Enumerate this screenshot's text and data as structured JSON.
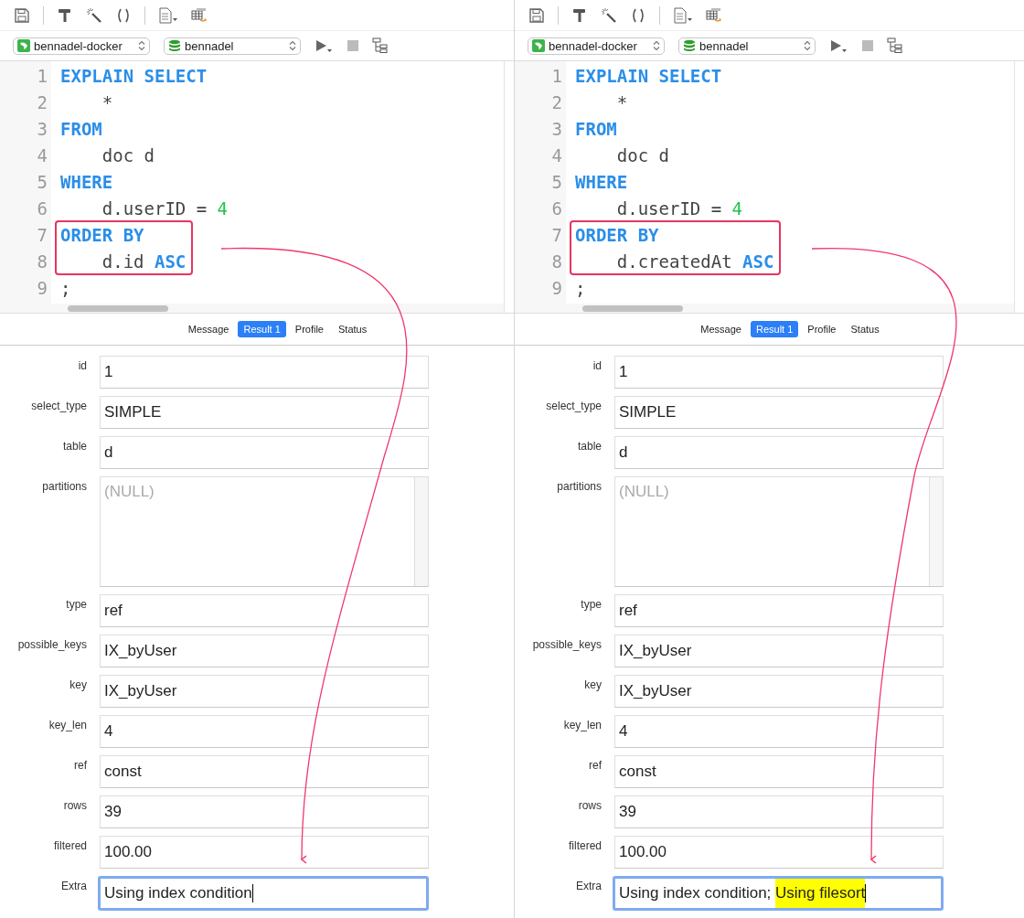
{
  "panes": [
    {
      "connection": "bennadel-docker",
      "database": "bennadel",
      "code_lines": [
        {
          "number": "1",
          "boxed": false,
          "tokens": [
            {
              "kind": "keyword",
              "text": "EXPLAIN SELECT"
            }
          ]
        },
        {
          "number": "2",
          "boxed": false,
          "tokens": [
            {
              "kind": "plain",
              "text": "    *"
            }
          ]
        },
        {
          "number": "3",
          "boxed": false,
          "tokens": [
            {
              "kind": "keyword",
              "text": "FROM"
            }
          ]
        },
        {
          "number": "4",
          "boxed": false,
          "tokens": [
            {
              "kind": "plain",
              "text": "    doc d"
            }
          ]
        },
        {
          "number": "5",
          "boxed": false,
          "tokens": [
            {
              "kind": "keyword",
              "text": "WHERE"
            }
          ]
        },
        {
          "number": "6",
          "boxed": false,
          "tokens": [
            {
              "kind": "plain",
              "text": "    d.userID = "
            },
            {
              "kind": "number",
              "text": "4"
            }
          ]
        },
        {
          "number": "7",
          "boxed": true,
          "tokens": [
            {
              "kind": "keyword",
              "text": "ORDER BY"
            }
          ]
        },
        {
          "number": "8",
          "boxed": true,
          "tokens": [
            {
              "kind": "plain",
              "text": "    d.id "
            },
            {
              "kind": "keyword",
              "text": "ASC"
            }
          ]
        },
        {
          "number": "9",
          "boxed": false,
          "tokens": [
            {
              "kind": "plain",
              "text": ";"
            }
          ]
        }
      ],
      "tabs": [
        {
          "label": "Message",
          "selected": false
        },
        {
          "label": "Result 1",
          "selected": true
        },
        {
          "label": "Profile",
          "selected": false
        },
        {
          "label": "Status",
          "selected": false
        }
      ],
      "fields": [
        {
          "label": "id",
          "kind": "text",
          "focused": false,
          "segments": [
            {
              "text": "1",
              "highlighted": false
            }
          ]
        },
        {
          "label": "select_type",
          "kind": "text",
          "focused": false,
          "segments": [
            {
              "text": "SIMPLE",
              "highlighted": false
            }
          ]
        },
        {
          "label": "table",
          "kind": "text",
          "focused": false,
          "segments": [
            {
              "text": "d",
              "highlighted": false
            }
          ]
        },
        {
          "label": "partitions",
          "kind": "null_memo",
          "focused": false,
          "segments": [
            {
              "text": "(NULL)",
              "highlighted": false
            }
          ]
        },
        {
          "label": "type",
          "kind": "text",
          "focused": false,
          "segments": [
            {
              "text": "ref",
              "highlighted": false
            }
          ]
        },
        {
          "label": "possible_keys",
          "kind": "text",
          "focused": false,
          "segments": [
            {
              "text": "IX_byUser",
              "highlighted": false
            }
          ]
        },
        {
          "label": "key",
          "kind": "text",
          "focused": false,
          "segments": [
            {
              "text": "IX_byUser",
              "highlighted": false
            }
          ]
        },
        {
          "label": "key_len",
          "kind": "text",
          "focused": false,
          "segments": [
            {
              "text": "4",
              "highlighted": false
            }
          ]
        },
        {
          "label": "ref",
          "kind": "text",
          "focused": false,
          "segments": [
            {
              "text": "const",
              "highlighted": false
            }
          ]
        },
        {
          "label": "rows",
          "kind": "text",
          "focused": false,
          "segments": [
            {
              "text": "39",
              "highlighted": false
            }
          ]
        },
        {
          "label": "filtered",
          "kind": "text",
          "focused": false,
          "segments": [
            {
              "text": "100.00",
              "highlighted": false
            }
          ]
        },
        {
          "label": "Extra",
          "kind": "text",
          "focused": true,
          "segments": [
            {
              "text": "Using index condition",
              "highlighted": false
            }
          ]
        }
      ]
    },
    {
      "connection": "bennadel-docker",
      "database": "bennadel",
      "code_lines": [
        {
          "number": "1",
          "boxed": false,
          "tokens": [
            {
              "kind": "keyword",
              "text": "EXPLAIN SELECT"
            }
          ]
        },
        {
          "number": "2",
          "boxed": false,
          "tokens": [
            {
              "kind": "plain",
              "text": "    *"
            }
          ]
        },
        {
          "number": "3",
          "boxed": false,
          "tokens": [
            {
              "kind": "keyword",
              "text": "FROM"
            }
          ]
        },
        {
          "number": "4",
          "boxed": false,
          "tokens": [
            {
              "kind": "plain",
              "text": "    doc d"
            }
          ]
        },
        {
          "number": "5",
          "boxed": false,
          "tokens": [
            {
              "kind": "keyword",
              "text": "WHERE"
            }
          ]
        },
        {
          "number": "6",
          "boxed": false,
          "tokens": [
            {
              "kind": "plain",
              "text": "    d.userID = "
            },
            {
              "kind": "number",
              "text": "4"
            }
          ]
        },
        {
          "number": "7",
          "boxed": true,
          "tokens": [
            {
              "kind": "keyword",
              "text": "ORDER BY"
            }
          ]
        },
        {
          "number": "8",
          "boxed": true,
          "tokens": [
            {
              "kind": "plain",
              "text": "    d.createdAt "
            },
            {
              "kind": "keyword",
              "text": "ASC"
            }
          ]
        },
        {
          "number": "9",
          "boxed": false,
          "tokens": [
            {
              "kind": "plain",
              "text": ";"
            }
          ]
        }
      ],
      "tabs": [
        {
          "label": "Message",
          "selected": false
        },
        {
          "label": "Result 1",
          "selected": true
        },
        {
          "label": "Profile",
          "selected": false
        },
        {
          "label": "Status",
          "selected": false
        }
      ],
      "fields": [
        {
          "label": "id",
          "kind": "text",
          "focused": false,
          "segments": [
            {
              "text": "1",
              "highlighted": false
            }
          ]
        },
        {
          "label": "select_type",
          "kind": "text",
          "focused": false,
          "segments": [
            {
              "text": "SIMPLE",
              "highlighted": false
            }
          ]
        },
        {
          "label": "table",
          "kind": "text",
          "focused": false,
          "segments": [
            {
              "text": "d",
              "highlighted": false
            }
          ]
        },
        {
          "label": "partitions",
          "kind": "null_memo",
          "focused": false,
          "segments": [
            {
              "text": "(NULL)",
              "highlighted": false
            }
          ]
        },
        {
          "label": "type",
          "kind": "text",
          "focused": false,
          "segments": [
            {
              "text": "ref",
              "highlighted": false
            }
          ]
        },
        {
          "label": "possible_keys",
          "kind": "text",
          "focused": false,
          "segments": [
            {
              "text": "IX_byUser",
              "highlighted": false
            }
          ]
        },
        {
          "label": "key",
          "kind": "text",
          "focused": false,
          "segments": [
            {
              "text": "IX_byUser",
              "highlighted": false
            }
          ]
        },
        {
          "label": "key_len",
          "kind": "text",
          "focused": false,
          "segments": [
            {
              "text": "4",
              "highlighted": false
            }
          ]
        },
        {
          "label": "ref",
          "kind": "text",
          "focused": false,
          "segments": [
            {
              "text": "const",
              "highlighted": false
            }
          ]
        },
        {
          "label": "rows",
          "kind": "text",
          "focused": false,
          "segments": [
            {
              "text": "39",
              "highlighted": false
            }
          ]
        },
        {
          "label": "filtered",
          "kind": "text",
          "focused": false,
          "segments": [
            {
              "text": "100.00",
              "highlighted": false
            }
          ]
        },
        {
          "label": "Extra",
          "kind": "text",
          "focused": true,
          "segments": [
            {
              "text": "Using index condition; ",
              "highlighted": false
            },
            {
              "text": "Using filesort",
              "highlighted": true
            }
          ]
        }
      ]
    }
  ]
}
